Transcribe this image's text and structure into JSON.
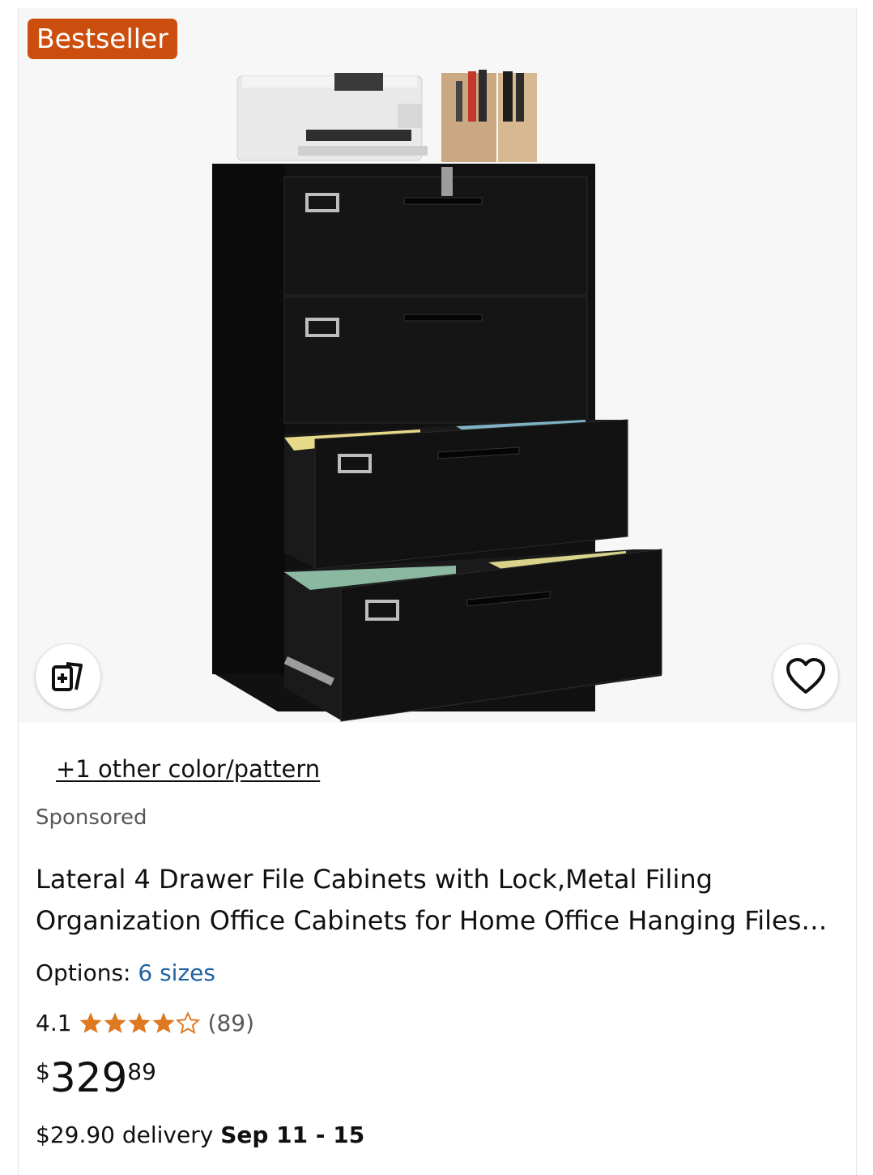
{
  "badge": {
    "label": "Bestseller",
    "color": "#cc4e0e"
  },
  "image": {
    "product_alt": "Black lateral 4 drawer file cabinet with printer and magazine holder on top"
  },
  "buttons": {
    "compare_icon": "compare-add-icon",
    "wishlist_icon": "heart-icon"
  },
  "swatch": {
    "label": "+1 other color/pattern"
  },
  "sponsored": "Sponsored",
  "product": {
    "title": "Lateral 4 Drawer File Cabinets with Lock,Metal Filing Organization Office Cabinets for Home Office Hanging Files…",
    "options_label": "Options:",
    "options_value": "6 sizes",
    "rating": "4.1",
    "rating_stars": 4.1,
    "review_count": "(89)",
    "price_symbol": "$",
    "price_whole": "329",
    "price_fraction": "89",
    "delivery_prefix": "$29.90 delivery",
    "delivery_date": "Sep 11 - 15"
  },
  "colors": {
    "star": "#de7921",
    "link": "#2162a1",
    "secondary_text": "#565959"
  }
}
